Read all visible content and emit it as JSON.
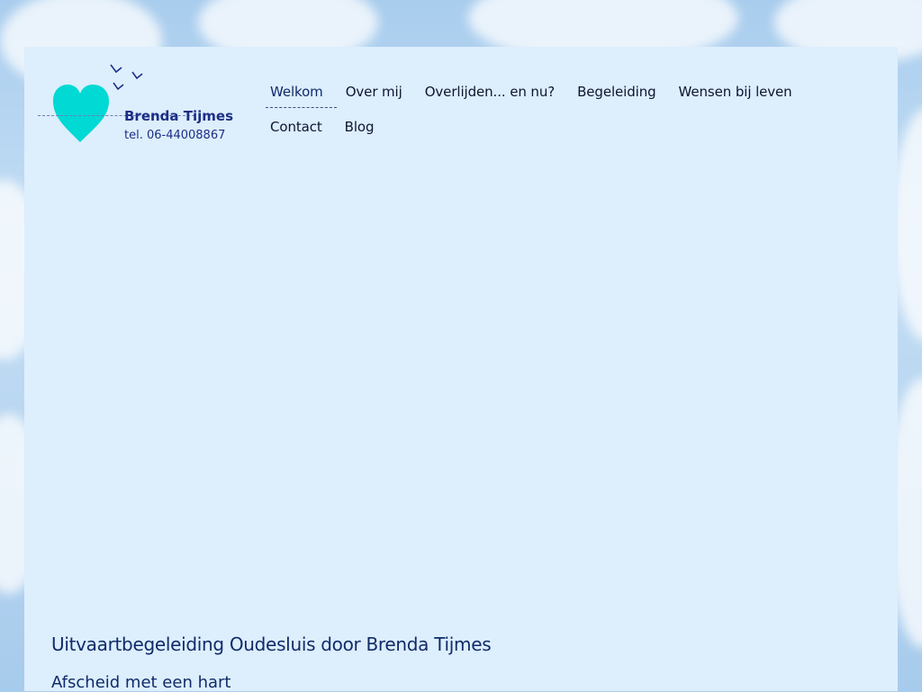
{
  "logo": {
    "name": "Brenda Tijmes",
    "phone": "tel. 06-44008867",
    "heart_color": "#00d9d4",
    "bird_color": "#1c2f86"
  },
  "nav": {
    "row1": [
      {
        "label": "Welkom",
        "active": true
      },
      {
        "label": "Over mij"
      },
      {
        "label": "Overlijden... en nu?"
      },
      {
        "label": "Begeleiding"
      },
      {
        "label": "Wensen bij leven"
      }
    ],
    "row2": [
      {
        "label": "Contact"
      },
      {
        "label": "Blog"
      }
    ]
  },
  "main": {
    "title": "Uitvaartbegeleiding Oudesluis door Brenda Tijmes",
    "subtitle": "Afscheid met een hart"
  },
  "colors": {
    "panel_bg": "#ddeefd",
    "heading": "#0f2b6a",
    "nav_text": "#0d1530"
  }
}
